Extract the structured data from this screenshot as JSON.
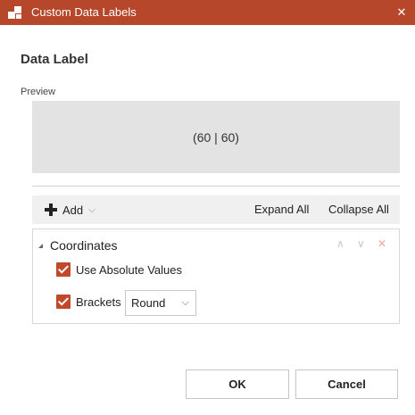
{
  "window": {
    "title": "Custom Data Labels",
    "close_glyph": "✕"
  },
  "heading": "Data Label",
  "preview": {
    "label": "Preview",
    "value": "(60 | 60)"
  },
  "toolbar": {
    "add_label": "Add",
    "add_caret": "⌵",
    "expand_all": "Expand All",
    "collapse_all": "Collapse All"
  },
  "group": {
    "title": "Coordinates",
    "up_glyph": "∧",
    "down_glyph": "∨",
    "remove_glyph": "✕",
    "use_absolute_values": {
      "label": "Use Absolute Values",
      "checked": true
    },
    "brackets": {
      "label": "Brackets",
      "checked": true,
      "selected": "Round",
      "caret": "⌵"
    }
  },
  "buttons": {
    "ok": "OK",
    "cancel": "Cancel"
  },
  "colors": {
    "titlebar": "#b7472a",
    "checkbox": "#c0482b",
    "preview_bg": "#e3e3e3"
  }
}
